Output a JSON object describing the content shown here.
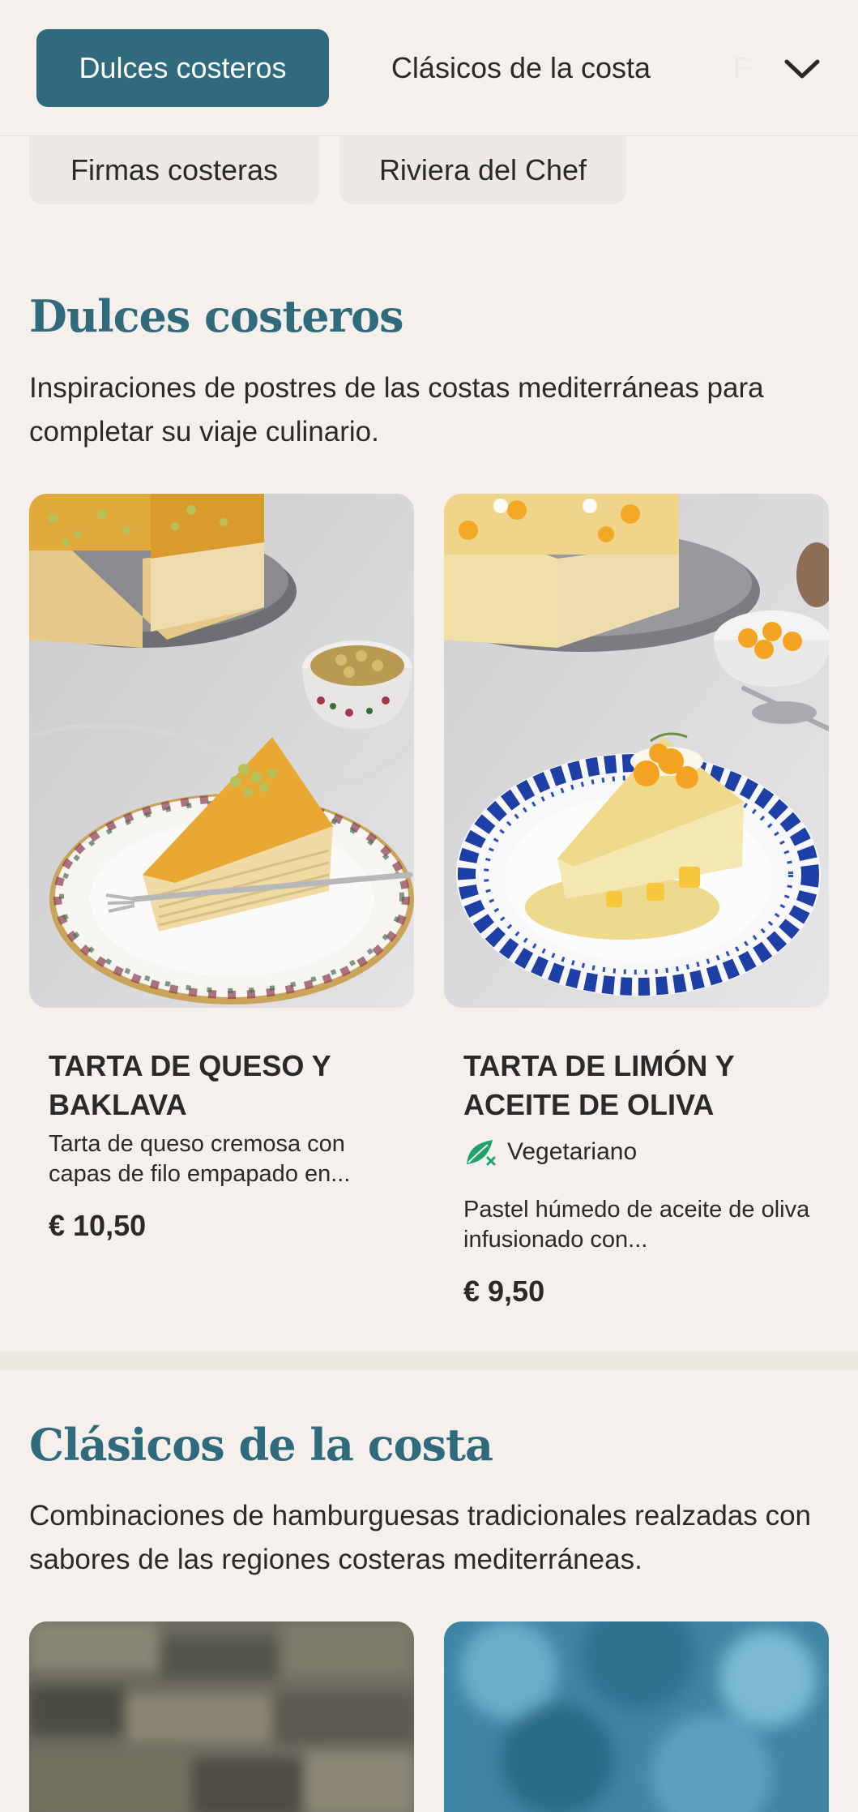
{
  "tabs": {
    "active": "Dulces costeros",
    "second": "Clásicos de la costa",
    "third_partial": "F"
  },
  "subtabs": [
    "Firmas costeras",
    "Riviera del Chef"
  ],
  "section1": {
    "title": "Dulces costeros",
    "description": "Inspiraciones de postres de las costas mediterráneas para completar su viaje culinario.",
    "cards": [
      {
        "title": "TARTA DE QUESO Y BAKLAVA",
        "description": "Tarta de queso cremosa con capas de filo empapado en...",
        "price": "€ 10,50"
      },
      {
        "title": "TARTA DE LIMÓN Y ACEITE DE OLIVA",
        "badge": "Vegetariano",
        "description": "Pastel húmedo de aceite de oliva infusionado con...",
        "price": "€ 9,50"
      }
    ]
  },
  "section2": {
    "title": "Clásicos de la costa",
    "description": "Combinaciones de hamburguesas tradicionales realzadas con sabores de las regiones costeras mediterráneas."
  },
  "colors": {
    "accent": "#2f6a7d",
    "background": "#f5f0ec",
    "vegetarian": "#1fa36a"
  },
  "icons": {
    "dropdown": "chevron-down-icon",
    "vegetarian": "vegetarian-leaf-icon"
  }
}
